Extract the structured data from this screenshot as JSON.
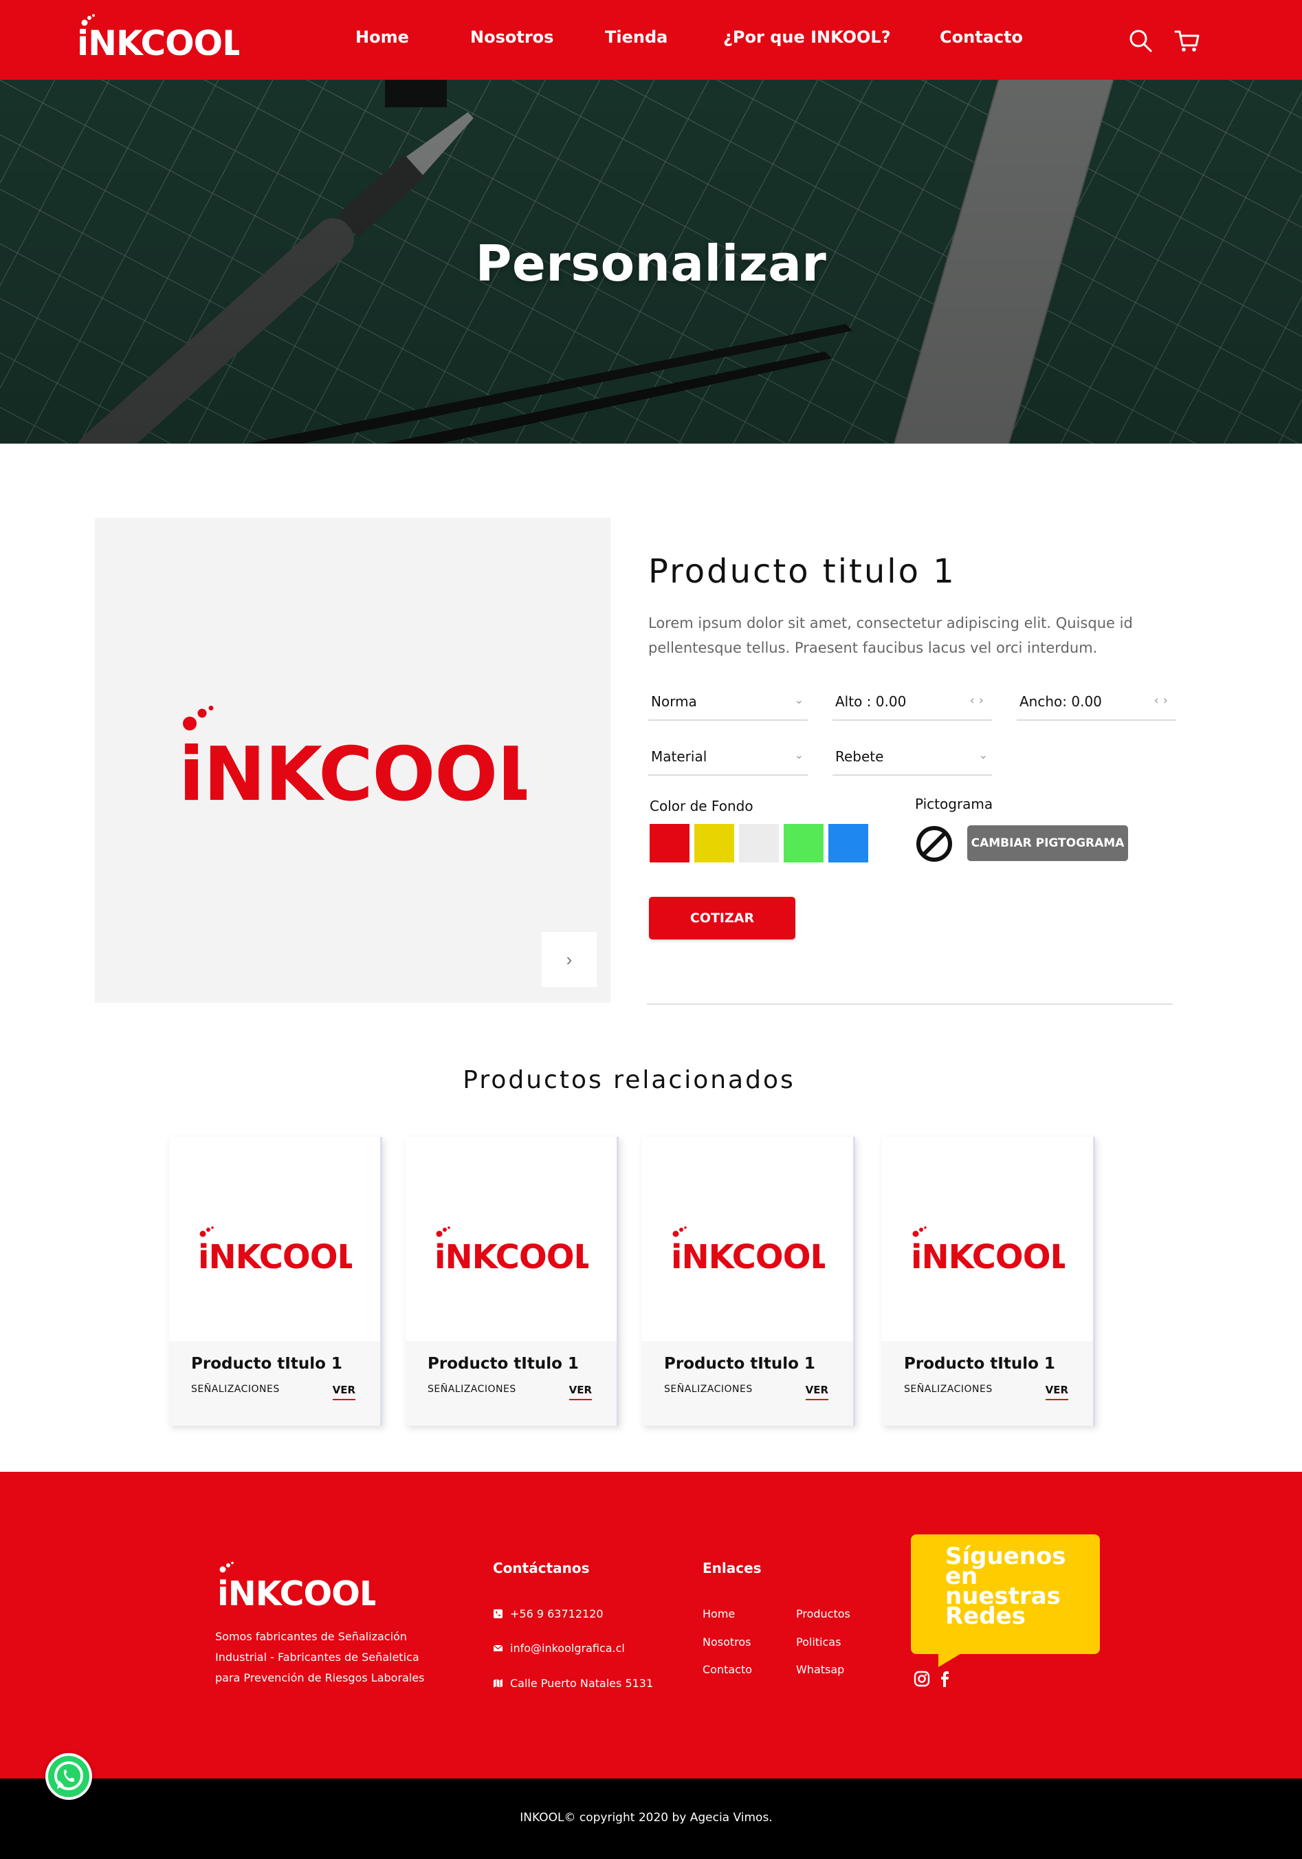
{
  "brand": {
    "name": "iNKCOOL",
    "primary_color": "#e30613",
    "accent_color": "#ffcc00"
  },
  "header": {
    "nav": [
      "Home",
      "Nosotros",
      "Tienda",
      "¿Por que INKOOL?",
      "Contacto"
    ],
    "icons": [
      "search-icon",
      "cart-icon"
    ]
  },
  "hero": {
    "title": "Personalizar"
  },
  "product": {
    "title": "Producto titulo 1",
    "description": "Lorem ipsum dolor sit amet, consectetur adipiscing elit. Quisque id pellentesque tellus. Praesent faucibus lacus vel orci interdum.",
    "fields": {
      "norma": "Norma",
      "alto": "Alto : 0.00",
      "ancho": "Ancho: 0.00",
      "material": "Material",
      "rebete": "Rebete"
    },
    "color_label": "Color de Fondo",
    "colors": [
      "#e30613",
      "#e8d400",
      "#ececec",
      "#55ea55",
      "#1e88f0"
    ],
    "pictogram_label": "Pictograma",
    "pictogram_icon": "prohibition-icon",
    "change_pictogram_label": "CAMBIAR PIGTOGRAMA",
    "quote_label": "COTIZAR"
  },
  "related": {
    "title": "Productos relacionados",
    "items": [
      {
        "title": "Producto tItulo 1",
        "category": "SEÑALIZACIONES",
        "action": "VER"
      },
      {
        "title": "Producto tItulo 1",
        "category": "SEÑALIZACIONES",
        "action": "VER"
      },
      {
        "title": "Producto tItulo 1",
        "category": "SEÑALIZACIONES",
        "action": "VER"
      },
      {
        "title": "Producto tItulo 1",
        "category": "SEÑALIZACIONES",
        "action": "VER"
      }
    ]
  },
  "footer": {
    "about": "Somos fabricantes de Señalización Industrial - Fabricantes de Señaletica para Prevención de Riesgos Laborales",
    "contact_title": "Contáctanos",
    "contact": [
      "+56 9 63712120",
      "info@inkoolgrafica.cl",
      "Calle Puerto Natales 5131"
    ],
    "links_title": "Enlaces",
    "links_col1": [
      "Home",
      "Nosotros",
      "Contacto"
    ],
    "links_col2": [
      "Productos",
      "Politicas",
      "Whatsap"
    ],
    "social_text": "Síguenos en nuestras Redes",
    "social_icons": [
      "instagram-icon",
      "facebook-icon"
    ],
    "copyright": "INKOOL© copyright 2020 by Agecia Vimos."
  },
  "floating": {
    "icon": "whatsapp-icon"
  }
}
